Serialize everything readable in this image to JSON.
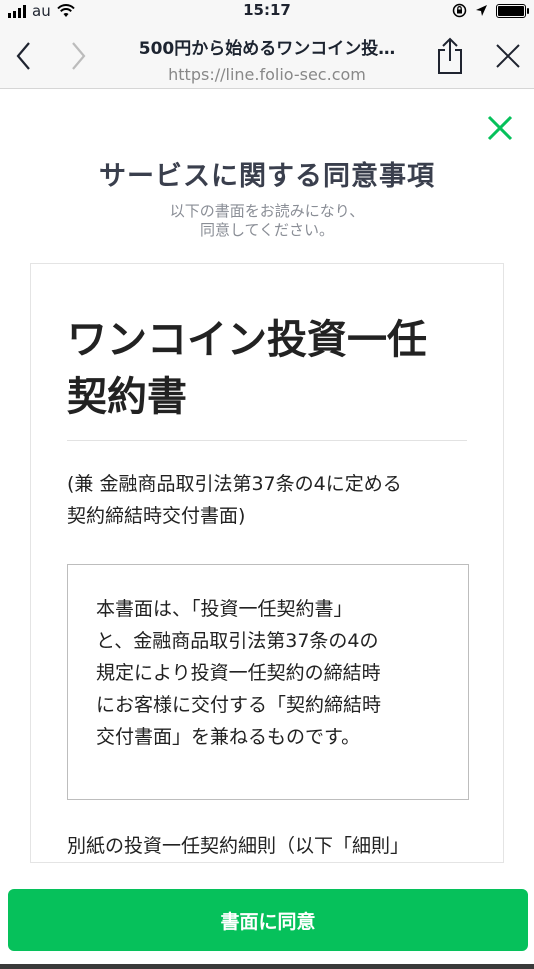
{
  "status_bar": {
    "carrier": "au",
    "time": "15:17"
  },
  "browser": {
    "page_title": "500円から始めるワンコイン投…",
    "url": "https://line.folio-sec.com"
  },
  "modal": {
    "heading": "サービスに関する同意事項",
    "instruction_line1": "以下の書面をお読みになり、",
    "instruction_line2": "同意してください。",
    "document": {
      "title_line1": "ワンコイン投資一任",
      "title_line2": "契約書",
      "subtitle_line1": "(兼 金融商品取引法第37条の4に定める",
      "subtitle_line2": "契約締結時交付書面)",
      "notice_lines": [
        "本書面は、「投資一任契約書」",
        "と、金融商品取引法第37条の4の",
        "規定により投資一任契約の締結時",
        "にお客様に交付する「契約締結時",
        "交付書面」を兼ねるものです。"
      ],
      "body_partial": "別紙の投資一任契約細則（以下「細則」"
    },
    "agree_button": "書面に同意"
  },
  "colors": {
    "accent_green": "#06c15b",
    "close_icon": "#06c15b"
  },
  "icons": [
    "signal-icon",
    "wifi-icon",
    "rotation-lock-icon",
    "location-icon",
    "battery-icon",
    "back-icon",
    "forward-icon",
    "share-icon",
    "close-icon"
  ]
}
